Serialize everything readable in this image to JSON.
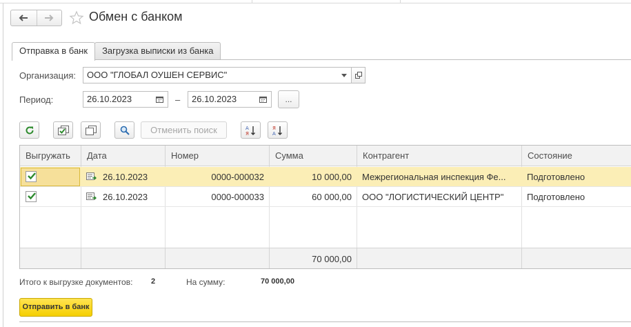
{
  "window": {
    "title": "Обмен с банком"
  },
  "nav": {
    "back_icon": "arrow-left-icon",
    "forward_icon": "arrow-right-icon",
    "favorite_icon": "star-icon"
  },
  "tabs": [
    {
      "label": "Отправка в банк",
      "active": true
    },
    {
      "label": "Загрузка выписки из банка",
      "active": false
    }
  ],
  "filters": {
    "organization_label": "Организация:",
    "organization_value": "ООО \"ГЛОБАЛ ОУШЕН СЕРВИС\"",
    "period_label": "Период:",
    "period_from": "26.10.2023",
    "period_dash": "–",
    "period_to": "26.10.2023",
    "period_more": "..."
  },
  "toolbar": {
    "refresh_icon": "refresh-icon",
    "check_all_icon": "check-all-icon",
    "uncheck_all_icon": "uncheck-all-icon",
    "search_icon": "search-icon",
    "cancel_search_label": "Отменить поиск",
    "sort_asc_icon": "sort-asc-icon",
    "sort_desc_icon": "sort-desc-icon"
  },
  "table": {
    "columns": [
      "Выгружать",
      "Дата",
      "Номер",
      "Сумма",
      "Контрагент",
      "Состояние"
    ],
    "rows": [
      {
        "export": true,
        "date": "26.10.2023",
        "number": "0000-000032",
        "amount": "10 000,00",
        "counterparty": "Межрегиональная инспекция Фе...",
        "status": "Подготовлено",
        "selected": true
      },
      {
        "export": true,
        "date": "26.10.2023",
        "number": "0000-000033",
        "amount": "60 000,00",
        "counterparty": "ООО  \"ЛОГИСТИЧЕСКИЙ ЦЕНТР\"",
        "status": "Подготовлено",
        "selected": false
      }
    ],
    "footer_total": "70 000,00"
  },
  "summary": {
    "docs_label": "Итого к выгрузке документов:",
    "docs_count": "2",
    "sum_label": "На сумму:",
    "sum_value": "70 000,00"
  },
  "actions": {
    "send_label": "Отправить в банк"
  },
  "colors": {
    "accent_yellow": "#f5cf00",
    "selected_row": "#fbeeb6",
    "check_green": "#2e8b2e"
  }
}
